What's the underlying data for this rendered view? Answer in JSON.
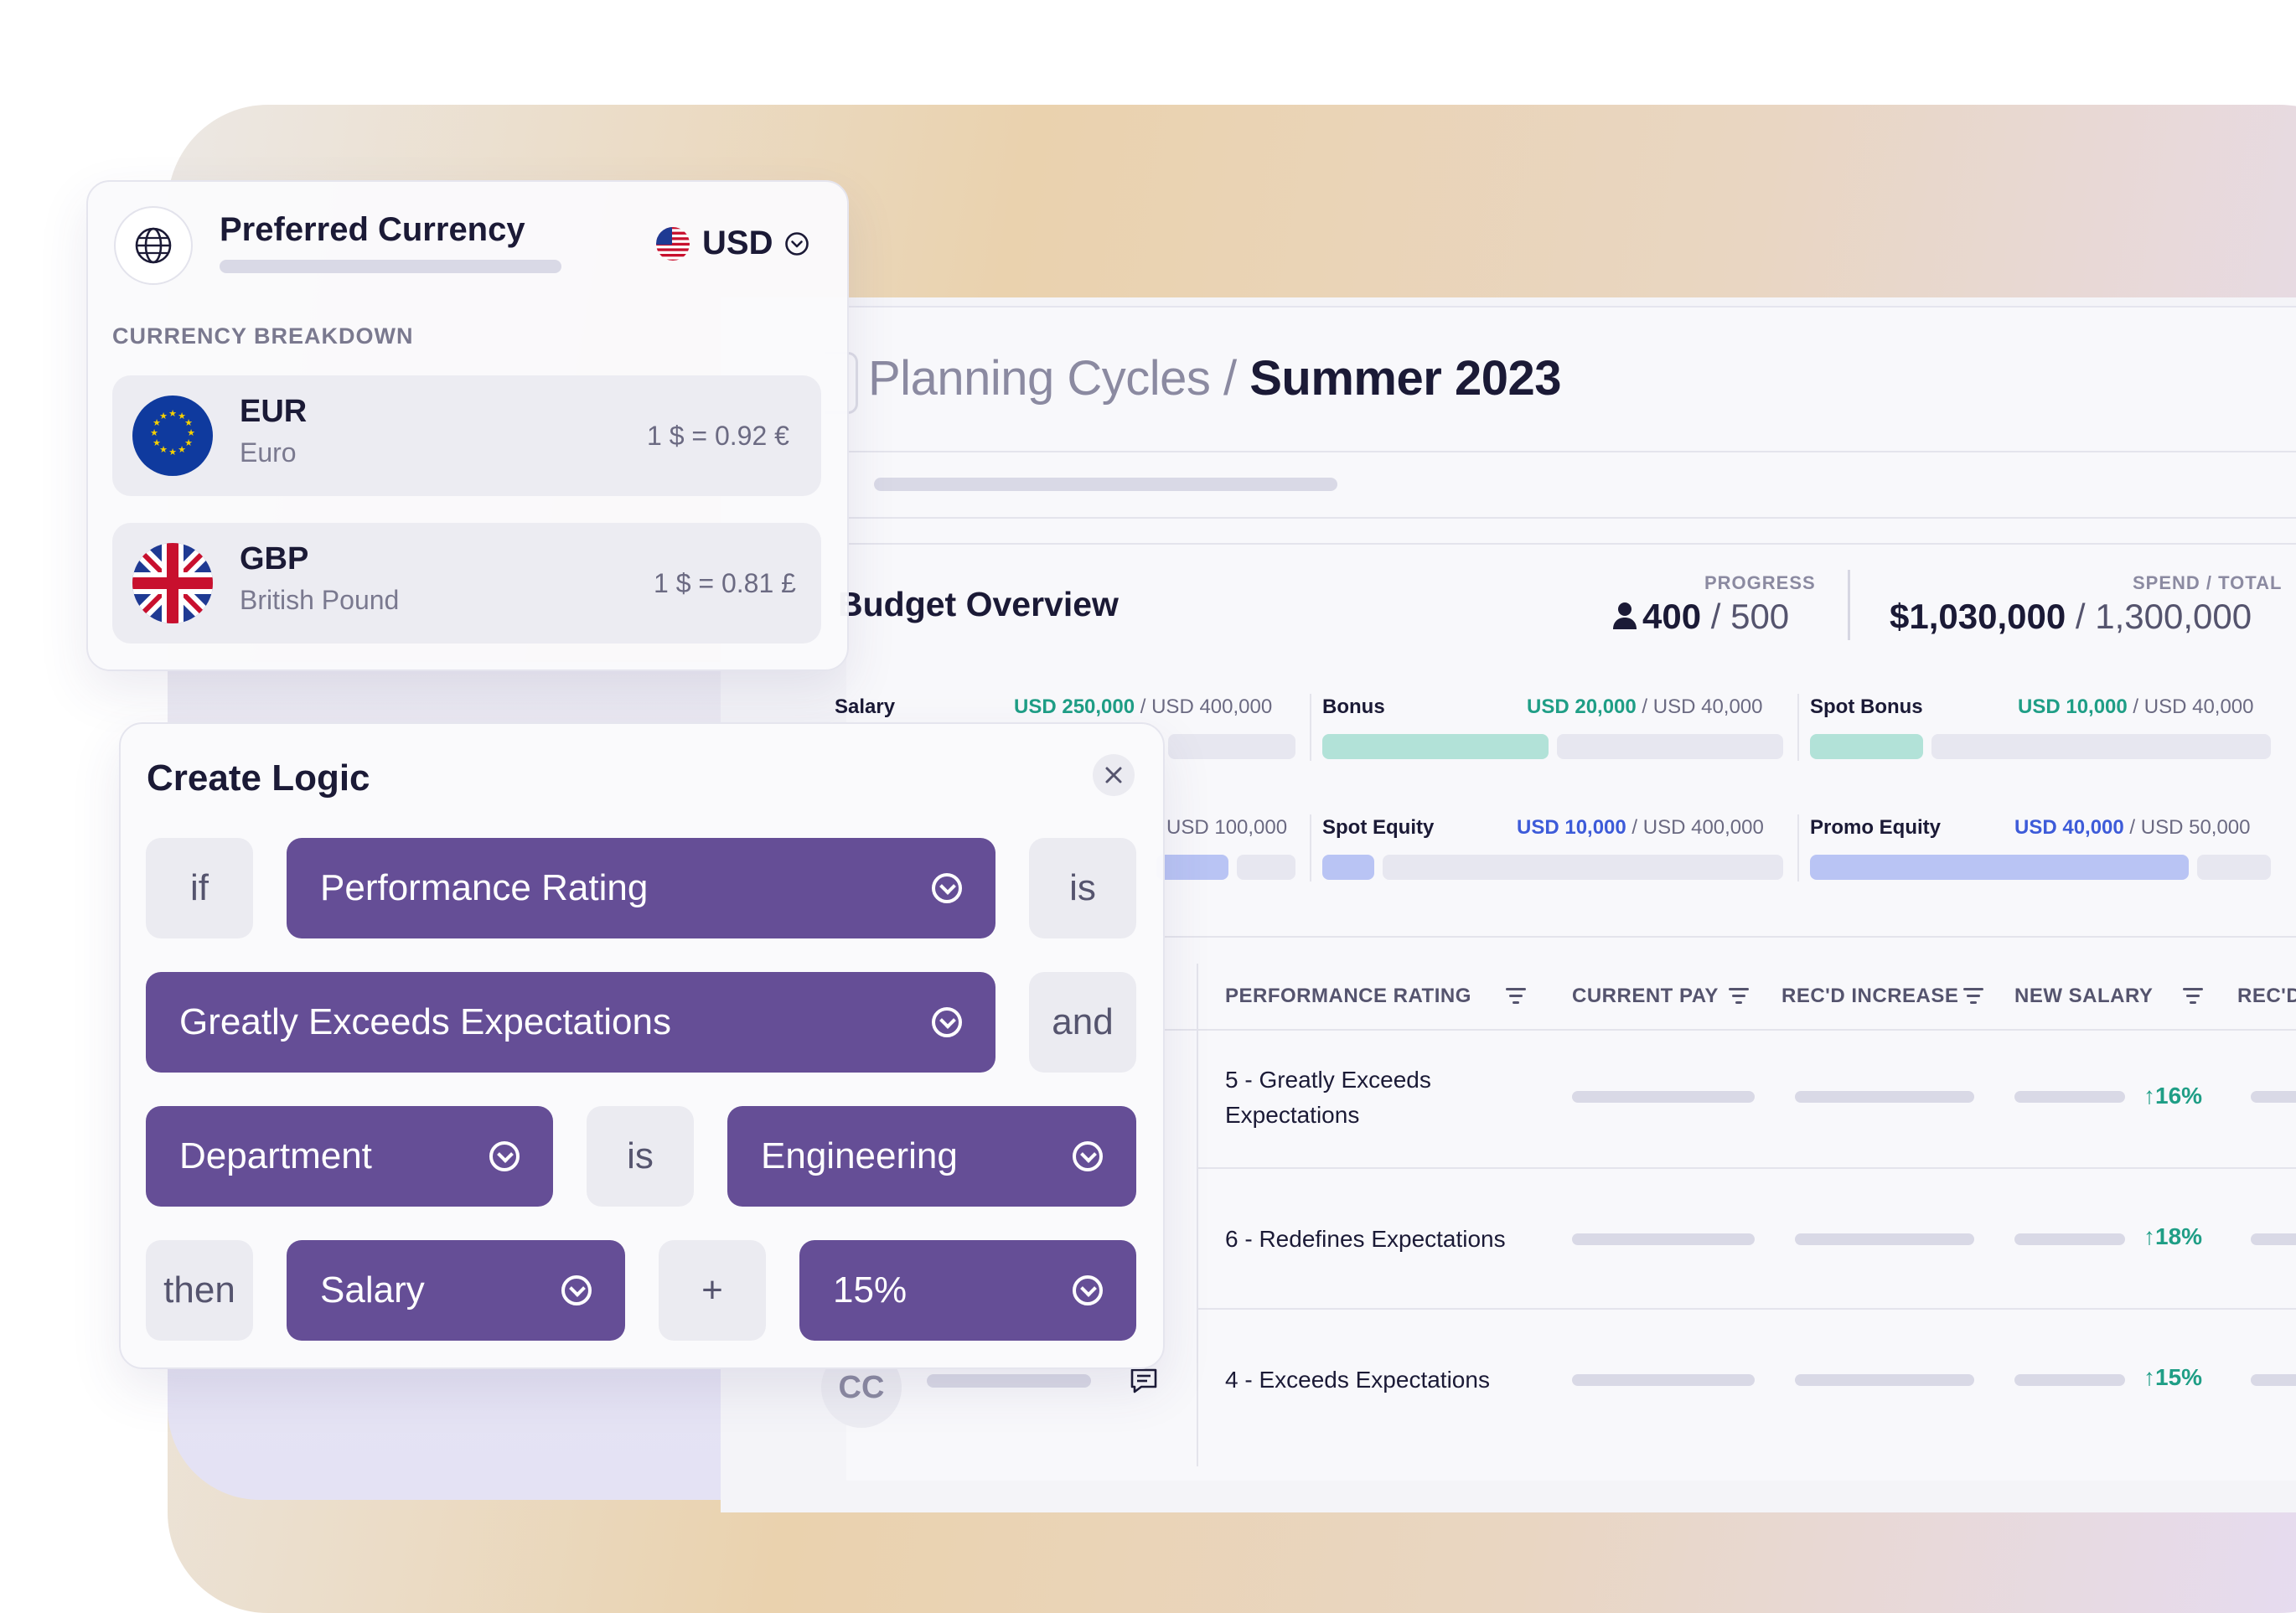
{
  "header": {
    "breadcrumb_parent": "Planning Cycles /",
    "breadcrumb_current": "Summer 2023"
  },
  "budget": {
    "title": "Budget Overview",
    "progress_label": "PROGRESS",
    "progress_current": "400",
    "progress_total": "/ 500",
    "spend_label": "SPEND / TOTAL",
    "spend_current": "$1,030,000",
    "spend_total": "/ 1,300,000",
    "categories": [
      {
        "name": "Salary",
        "spent": "USD 250,000",
        "total": "/ USD 400,000",
        "fill": 0.625
      },
      {
        "name": "Bonus",
        "spent": "USD 20,000",
        "total": "/ USD 40,000",
        "fill": 0.5
      },
      {
        "name": "Spot Bonus",
        "spent": "USD 10,000",
        "total": "/ USD 40,000",
        "fill": 0.25
      },
      {
        "name": "",
        "spent": "",
        "total": "USD 100,000",
        "fill": 0.5
      },
      {
        "name": "Spot Equity",
        "spent": "USD 10,000",
        "total": "/ USD 400,000",
        "fill": 0.025
      },
      {
        "name": "Promo Equity",
        "spent": "USD 40,000",
        "total": "/ USD 50,000",
        "fill": 0.8
      }
    ]
  },
  "table": {
    "columns": [
      "PERFORMANCE RATING",
      "CURRENT PAY",
      "REC'D INCREASE",
      "NEW SALARY",
      "REC'D"
    ],
    "rows": [
      {
        "rating": "5 - Greatly Exceeds Expectations",
        "change": "↑16%"
      },
      {
        "rating": "6 - Redefines Expectations",
        "change": "↑18%"
      },
      {
        "rating": "4 - Exceeds Expectations",
        "change": "↑15%"
      }
    ],
    "avatar_initials": "CC"
  },
  "currency": {
    "title": "Preferred Currency",
    "selected": "USD",
    "section_label": "CURRENCY BREAKDOWN",
    "items": [
      {
        "code": "EUR",
        "name": "Euro",
        "rate": "1 $ = 0.92 €"
      },
      {
        "code": "GBP",
        "name": "British Pound",
        "rate": "1 $ = 0.81 £"
      }
    ]
  },
  "logic": {
    "title": "Create Logic",
    "if": "if",
    "field1": "Performance Rating",
    "is1": "is",
    "value1": "Greatly Exceeds Expectations",
    "and": "and",
    "field2": "Department",
    "is2": "is",
    "value2": "Engineering",
    "then": "then",
    "target": "Salary",
    "op": "+",
    "amount": "15%"
  },
  "colors": {
    "accent_purple": "#654e96",
    "positive_green": "#1f9e86",
    "equity_blue": "#b9c4f4",
    "bonus_teal": "#b2e2d8"
  }
}
